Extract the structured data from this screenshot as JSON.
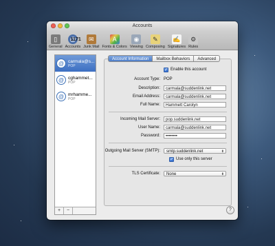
{
  "window": {
    "title": "Accounts"
  },
  "toolbar": {
    "items": [
      {
        "label": "General",
        "icon": "switch-icon"
      },
      {
        "label": "Accounts",
        "icon": "at-icon"
      },
      {
        "label": "Junk Mail",
        "icon": "junk-mail-icon"
      },
      {
        "label": "Fonts & Colors",
        "icon": "fonts-colors-icon"
      },
      {
        "label": "Viewing",
        "icon": "viewing-icon"
      },
      {
        "label": "Composing",
        "icon": "composing-icon"
      },
      {
        "label": "Signatures",
        "icon": "signature-icon"
      },
      {
        "label": "Rules",
        "icon": "rules-icon"
      }
    ],
    "overlay_number": "1171"
  },
  "sidebar": {
    "accounts": [
      {
        "name": "carmala@s...",
        "type": "POP"
      },
      {
        "name": "cghammet...",
        "type": "POP"
      },
      {
        "name": "mrhamme...",
        "type": "POP"
      }
    ],
    "add_label": "+",
    "remove_label": "−"
  },
  "tabs": [
    "Account Information",
    "Mailbox Behaviors",
    "Advanced"
  ],
  "form": {
    "enable_label": "Enable this account",
    "account_type_label": "Account Type:",
    "account_type_value": "POP",
    "description_label": "Description:",
    "description_value": "carmala@suddenlink.net",
    "email_label": "Email Address:",
    "email_value": "carmala@suddenlink.net",
    "fullname_label": "Full Name:",
    "fullname_value": "Hammett Carolyn",
    "incoming_label": "Incoming Mail Server:",
    "incoming_value": "pop.suddenlink.net",
    "username_label": "User Name:",
    "username_value": "carmala@suddenlink.net",
    "password_label": "Password:",
    "password_value": "••••••••",
    "smtp_label": "Outgoing Mail Server (SMTP):",
    "smtp_value": "smtp.suddenlink.net",
    "use_only_label": "Use only this server",
    "tls_label": "TLS Certificate:",
    "tls_value": "None"
  },
  "help_label": "?"
}
